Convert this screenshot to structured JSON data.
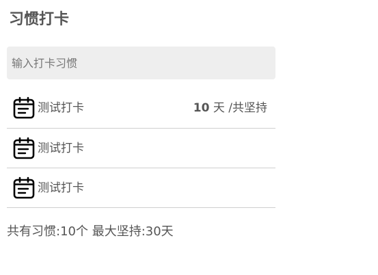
{
  "page": {
    "title": "习惯打卡"
  },
  "input": {
    "placeholder": "输入打卡习惯"
  },
  "habits": [
    {
      "name": "测试打卡",
      "icon": "calendar-icon",
      "streak_value": "10",
      "streak_unit": " 天 /共坚持"
    },
    {
      "name": "测试打卡",
      "icon": "calendar-icon"
    },
    {
      "name": "测试打卡",
      "icon": "calendar-icon"
    }
  ],
  "summary": {
    "total_label": "共有习惯:",
    "total_value": "10个",
    "max_label": " 最大坚持:",
    "max_value": "30天"
  },
  "colors": {
    "text": "#555555",
    "input_bg": "#eeeeee",
    "divider": "#cfcfcf"
  }
}
